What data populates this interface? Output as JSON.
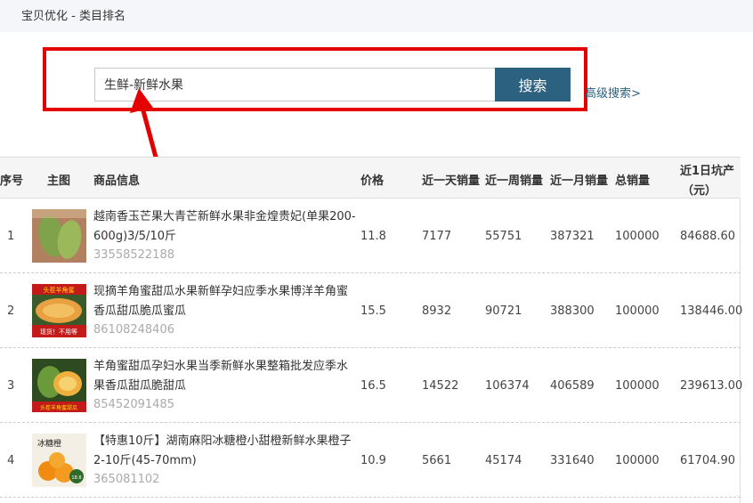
{
  "header": {
    "title": "宝贝优化 - 类目排名"
  },
  "search": {
    "value": "生鲜-新鲜水果",
    "button_label": "搜索",
    "advanced_link": "高级搜索>"
  },
  "table": {
    "headers": {
      "index": "序号",
      "image": "主图",
      "info": "商品信息",
      "price": "价格",
      "day_sales": "近一天销量",
      "week_sales": "近一周销量",
      "month_sales": "近一月销量",
      "total_sales": "总销量",
      "day_revenue_line1": "近1日坑产",
      "day_revenue_line2": "（元）"
    },
    "rows": [
      {
        "index": "1",
        "name": "越南香玉芒果大青芒新鲜水果非金煌贵妃(单果200-600g)3/5/10斤",
        "id": "33558522188",
        "price": "11.8",
        "day": "7177",
        "week": "55751",
        "month": "387321",
        "total": "100000",
        "revenue": "84688.60"
      },
      {
        "index": "2",
        "name": "现摘羊角蜜甜瓜水果新鲜孕妇应季水果博洋羊角蜜香瓜甜瓜脆瓜蜜瓜",
        "id": "86108248406",
        "price": "15.5",
        "day": "8932",
        "week": "90721",
        "month": "388300",
        "total": "100000",
        "revenue": "138446.00",
        "image_text_1": "头茬羊角蜜",
        "image_text_2": "现货！不用等"
      },
      {
        "index": "3",
        "name": "羊角蜜甜瓜孕妇水果当季新鲜水果整箱批发应季水果香瓜甜瓜脆甜瓜",
        "id": "85452091485",
        "price": "16.5",
        "day": "14522",
        "week": "106374",
        "month": "406589",
        "total": "100000",
        "revenue": "239613.00",
        "image_text_1": "头茬羊角蜜甜瓜"
      },
      {
        "index": "4",
        "name": "【特惠10斤】湖南麻阳冰糖橙小甜橙新鲜水果橙子2-10斤(45-70mm)",
        "id": "365081102",
        "price": "10.9",
        "day": "5661",
        "week": "45174",
        "month": "331640",
        "total": "100000",
        "revenue": "61704.90",
        "image_text_1": "冰糖橙",
        "image_text_2": "18.8"
      }
    ]
  },
  "colors": {
    "highlight": "#e50000",
    "button": "#2c6180",
    "link": "#2c6180",
    "id_text": "#aaaaaa"
  }
}
